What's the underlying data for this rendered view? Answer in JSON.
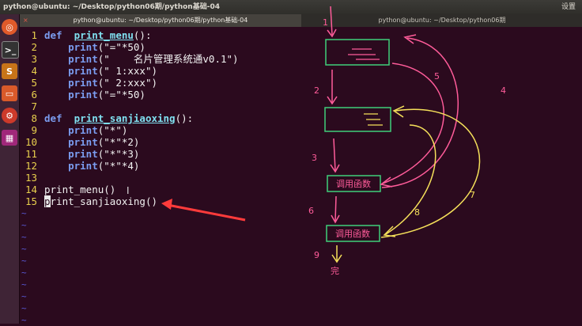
{
  "topbar": {
    "window_title": "python@ubuntu: ~/Desktop/python06期/python基础-04",
    "right_text": "设置"
  },
  "tabs": [
    {
      "label": "python@ubuntu: ~/Desktop/python06期/python基础-04",
      "close_icon": "×"
    },
    {
      "label": "python@ubuntu: ~/Desktop/python06期"
    }
  ],
  "code_lines": [
    {
      "num": "1",
      "segments": [
        [
          "kw",
          "def"
        ],
        [
          "",
          "  "
        ],
        [
          "fn",
          "print_menu"
        ],
        [
          "",
          "():"
        ]
      ]
    },
    {
      "num": "2",
      "segments": [
        [
          "",
          "    "
        ],
        [
          "kw",
          "print"
        ],
        [
          "",
          "(\"=\"*50)"
        ]
      ]
    },
    {
      "num": "3",
      "segments": [
        [
          "",
          "    "
        ],
        [
          "kw",
          "print"
        ],
        [
          "",
          "(\"    名片管理系统通v0.1\")"
        ]
      ]
    },
    {
      "num": "4",
      "segments": [
        [
          "",
          "    "
        ],
        [
          "kw",
          "print"
        ],
        [
          "",
          "(\" 1:xxx\")"
        ]
      ]
    },
    {
      "num": "5",
      "segments": [
        [
          "",
          "    "
        ],
        [
          "kw",
          "print"
        ],
        [
          "",
          "(\" 2:xxx\")"
        ]
      ]
    },
    {
      "num": "6",
      "segments": [
        [
          "",
          "    "
        ],
        [
          "kw",
          "print"
        ],
        [
          "",
          "(\"=\"*50)"
        ]
      ]
    },
    {
      "num": "7",
      "segments": []
    },
    {
      "num": "8",
      "segments": [
        [
          "kw",
          "def"
        ],
        [
          "",
          "  "
        ],
        [
          "fn",
          "print_sanjiaoxing"
        ],
        [
          "",
          "():"
        ]
      ]
    },
    {
      "num": "9",
      "segments": [
        [
          "",
          "    "
        ],
        [
          "kw",
          "print"
        ],
        [
          "",
          "(\"*\")"
        ]
      ]
    },
    {
      "num": "10",
      "segments": [
        [
          "",
          "    "
        ],
        [
          "kw",
          "print"
        ],
        [
          "",
          "(\"*\"*2)"
        ]
      ]
    },
    {
      "num": "11",
      "segments": [
        [
          "",
          "    "
        ],
        [
          "kw",
          "print"
        ],
        [
          "",
          "(\"*\"*3)"
        ]
      ]
    },
    {
      "num": "12",
      "segments": [
        [
          "",
          "    "
        ],
        [
          "kw",
          "print"
        ],
        [
          "",
          "(\"*\"*4)"
        ]
      ]
    },
    {
      "num": "13",
      "segments": []
    },
    {
      "num": "14",
      "segments": [
        [
          "",
          "print_menu()"
        ]
      ]
    },
    {
      "num": "15",
      "segments": [
        [
          "cursor",
          "p"
        ],
        [
          "",
          "rint_sanjiaoxing()"
        ]
      ]
    }
  ],
  "tilde": "~",
  "annotations": {
    "box_label_1": "三",
    "box_label_2": "三",
    "call_label_1": "调用函数",
    "call_label_2": "调用函数",
    "step_numbers": [
      "1",
      "2",
      "3",
      "4",
      "5",
      "6",
      "7",
      "8",
      "9"
    ],
    "done": "完"
  },
  "colors": {
    "background": "#2b0a1e",
    "pink": "#ff5c9a",
    "yellow": "#f5e05a",
    "green": "#3fd07a",
    "red": "#ff3b3b"
  }
}
